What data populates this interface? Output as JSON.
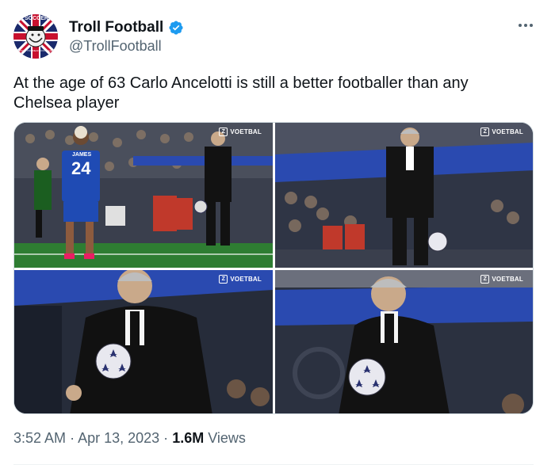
{
  "author": {
    "display_name": "Troll Football",
    "handle": "@TrollFootball",
    "verified": true,
    "avatar_text_top": "SOCCER",
    "avatar_text_bottom": "DON'T YOU MEAN FOOTBALL"
  },
  "tweet": {
    "text": "At the age of 63 Carlo Ancelotti is still a better footballer than any Chelsea player"
  },
  "media": {
    "watermark": "VOETBAL",
    "watermark_glyph": "Z",
    "player_name": "JAMES",
    "player_number": "24"
  },
  "meta": {
    "time": "3:52 AM",
    "separator": "·",
    "date": "Apr 13, 2023",
    "views_count": "1.6M",
    "views_label": "Views"
  },
  "colors": {
    "text": "#0f1419",
    "secondary": "#536471",
    "verified_blue": "#1d9bf0",
    "chelsea_blue": "#1f4bb4"
  },
  "icons": {
    "more": "more-horizontal-icon",
    "verified": "verified-badge-icon"
  }
}
